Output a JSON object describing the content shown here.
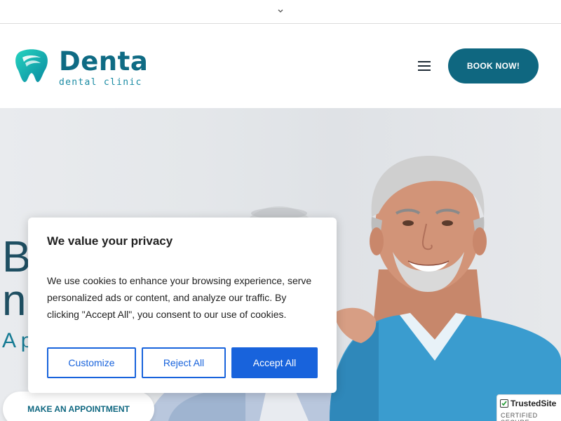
{
  "topbar": {
    "toggle_icon": "chevron-down-icon"
  },
  "brand": {
    "name": "Denta",
    "tagline": "dental clinic",
    "mark_color_1": "#1fc7b5",
    "mark_color_2": "#0b8f9e"
  },
  "header": {
    "menu_icon": "hamburger-icon",
    "book_label": "BOOK NOW!"
  },
  "hero": {
    "line1": "B",
    "line2": "n",
    "line3": "A p",
    "appointment_label": "MAKE AN APPOINTMENT"
  },
  "cookie_banner": {
    "title": "We value your privacy",
    "body": "We use cookies to enhance your browsing experience, serve personalized ads or content, and analyze our traffic. By clicking \"Accept All\", you consent to our use of cookies.",
    "customize_label": "Customize",
    "reject_label": "Reject All",
    "accept_label": "Accept All"
  },
  "trust_badge": {
    "name": "TrustedSite",
    "sub": "CERTIFIED SECURE"
  },
  "colors": {
    "brand": "#0f6780",
    "accent_blue": "#1863dc",
    "sweater": "#3a9ccf"
  }
}
